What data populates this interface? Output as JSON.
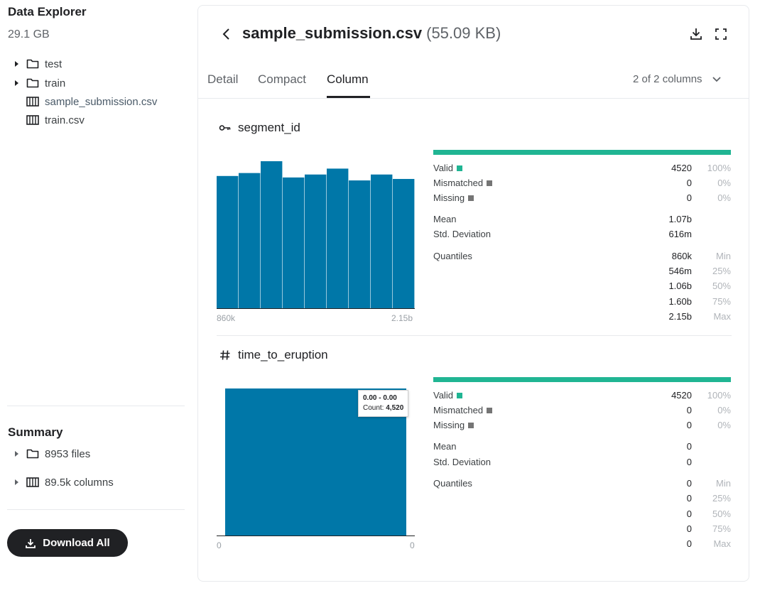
{
  "sidebar": {
    "title": "Data Explorer",
    "size": "29.1 GB",
    "tree": [
      {
        "label": "test",
        "type": "folder"
      },
      {
        "label": "train",
        "type": "folder"
      },
      {
        "label": "sample_submission.csv",
        "type": "table"
      },
      {
        "label": "train.csv",
        "type": "table"
      }
    ],
    "summary": {
      "title": "Summary",
      "files": "8953 files",
      "columns": "89.5k columns"
    },
    "download_label": "Download All"
  },
  "header": {
    "filename": "sample_submission.csv",
    "filesize": "(55.09 KB)"
  },
  "tabs": [
    {
      "label": "Detail",
      "active": false
    },
    {
      "label": "Compact",
      "active": false
    },
    {
      "label": "Column",
      "active": true
    }
  ],
  "column_select": "2 of 2 columns",
  "columns": [
    {
      "name": "segment_id",
      "icon": "key-icon",
      "histogram": {
        "values": [
          0.9,
          0.92,
          1.0,
          0.89,
          0.91,
          0.95,
          0.87,
          0.91,
          0.88
        ],
        "x_min_label": "860k",
        "x_max_label": "2.15b"
      },
      "stats": {
        "valid_label": "Valid",
        "valid_value": "4520",
        "valid_pct": "100%",
        "mismatched_label": "Mismatched",
        "mismatched_value": "0",
        "mismatched_pct": "0%",
        "missing_label": "Missing",
        "missing_value": "0",
        "missing_pct": "0%",
        "mean_label": "Mean",
        "mean_value": "1.07b",
        "std_label": "Std. Deviation",
        "std_value": "616m",
        "quantiles_label": "Quantiles",
        "quantiles": [
          {
            "value": "860k",
            "label": "Min"
          },
          {
            "value": "546m",
            "label": "25%"
          },
          {
            "value": "1.06b",
            "label": "50%"
          },
          {
            "value": "1.60b",
            "label": "75%"
          },
          {
            "value": "2.15b",
            "label": "Max"
          }
        ]
      }
    },
    {
      "name": "time_to_eruption",
      "icon": "hash-icon",
      "histogram": {
        "values": [
          1.0
        ],
        "x_min_label": "0",
        "x_max_label": "0"
      },
      "tooltip": {
        "range": "0.00 - 0.00",
        "count_label": "Count:",
        "count_value": "4,520"
      },
      "stats": {
        "valid_label": "Valid",
        "valid_value": "4520",
        "valid_pct": "100%",
        "mismatched_label": "Mismatched",
        "mismatched_value": "0",
        "mismatched_pct": "0%",
        "missing_label": "Missing",
        "missing_value": "0",
        "missing_pct": "0%",
        "mean_label": "Mean",
        "mean_value": "0",
        "std_label": "Std. Deviation",
        "std_value": "0",
        "quantiles_label": "Quantiles",
        "quantiles": [
          {
            "value": "0",
            "label": "Min"
          },
          {
            "value": "0",
            "label": "25%"
          },
          {
            "value": "0",
            "label": "50%"
          },
          {
            "value": "0",
            "label": "75%"
          },
          {
            "value": "0",
            "label": "Max"
          }
        ]
      }
    }
  ],
  "colors": {
    "bar": "#0077a8",
    "valid": "#20b593",
    "accent": "#202124"
  }
}
